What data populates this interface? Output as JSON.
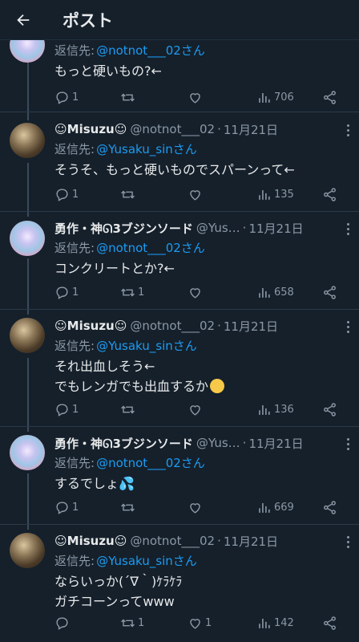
{
  "header": {
    "title": "ポスト"
  },
  "top_reply": {
    "reply_prefix": "返信先:",
    "reply_to": "@notnot___02さん",
    "text": "もっと硬いもの?←",
    "actions": {
      "replies": "1",
      "retweets": "",
      "likes": "",
      "views": "706"
    }
  },
  "tweets": [
    {
      "name": "☺Misuzu☺",
      "handle": "@notnot___02",
      "date": "11月21日",
      "reply_prefix": "返信先:",
      "reply_to": "@Yusaku_sinさん",
      "lines": [
        "そうそ、もっと硬いものでスパーンって←"
      ],
      "actions": {
        "replies": "1",
        "retweets": "",
        "likes": "",
        "views": "135"
      }
    },
    {
      "name": "勇作・神ᘏ3ブジンソード",
      "handle": "@Yus…",
      "date": "11月21日",
      "reply_prefix": "返信先:",
      "reply_to": "@notnot___02さん",
      "lines": [
        "コンクリートとか?←"
      ],
      "actions": {
        "replies": "1",
        "retweets": "1",
        "likes": "",
        "views": "658"
      }
    },
    {
      "name": "☺Misuzu☺",
      "handle": "@notnot___02",
      "date": "11月21日",
      "reply_prefix": "返信先:",
      "reply_to": "@Yusaku_sinさん",
      "lines": [
        "それ出血しそう←",
        "でもレンガでも出血するか"
      ],
      "actions": {
        "replies": "1",
        "retweets": "",
        "likes": "",
        "views": "136"
      }
    },
    {
      "name": "勇作・神ᘏ3ブジンソード",
      "handle": "@Yus…",
      "date": "11月21日",
      "reply_prefix": "返信先:",
      "reply_to": "@notnot___02さん",
      "lines": [
        "するでしょ"
      ],
      "actions": {
        "replies": "1",
        "retweets": "",
        "likes": "",
        "views": "669"
      }
    },
    {
      "name": "☺Misuzu☺",
      "handle": "@notnot___02",
      "date": "11月21日",
      "reply_prefix": "返信先:",
      "reply_to": "@Yusaku_sinさん",
      "lines": [
        "ならいっか(´∇｀)ｹﾗｹﾗ",
        "ガチコーンってwww"
      ],
      "actions": {
        "replies": "",
        "retweets": "1",
        "likes": "1",
        "views": "142"
      }
    }
  ],
  "date_separator": "·",
  "colors": {
    "background": "#15202b",
    "accent": "#1d9bf0",
    "muted": "#8b98a5"
  }
}
